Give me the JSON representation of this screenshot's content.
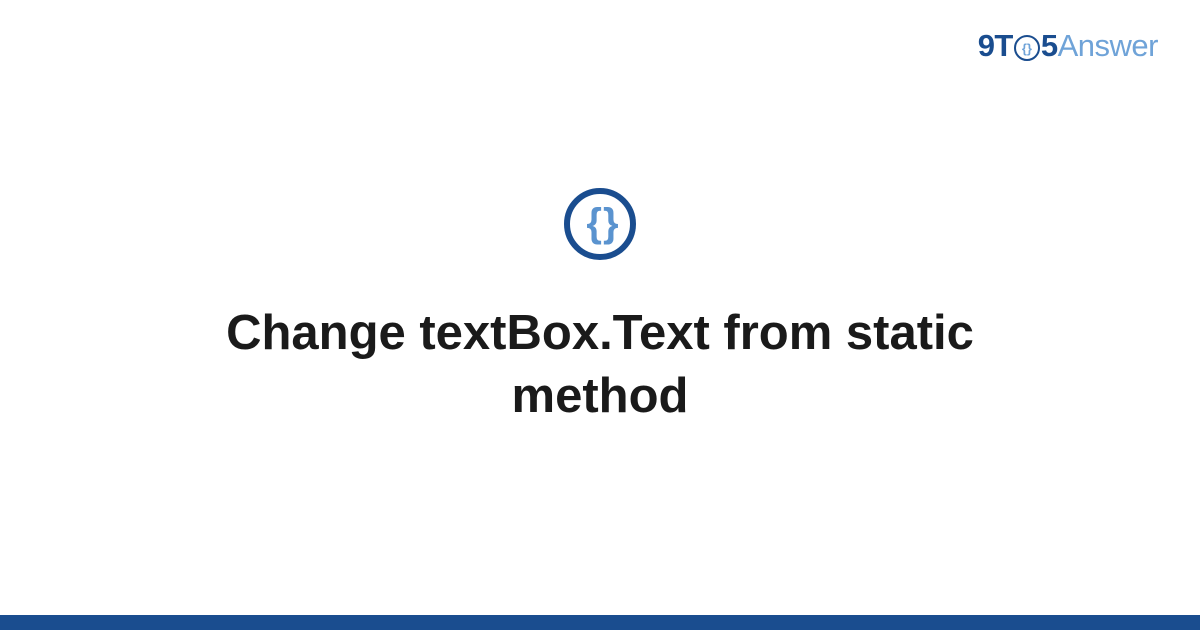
{
  "logo": {
    "prefix": "9T",
    "circle_inner": "{}",
    "mid": "5",
    "suffix": "Answer"
  },
  "icon": {
    "braces": "{ }"
  },
  "title": "Change textBox.Text from static method",
  "colors": {
    "primary": "#1a4d8f",
    "accent": "#6fa3d8",
    "text": "#1a1a1a"
  }
}
